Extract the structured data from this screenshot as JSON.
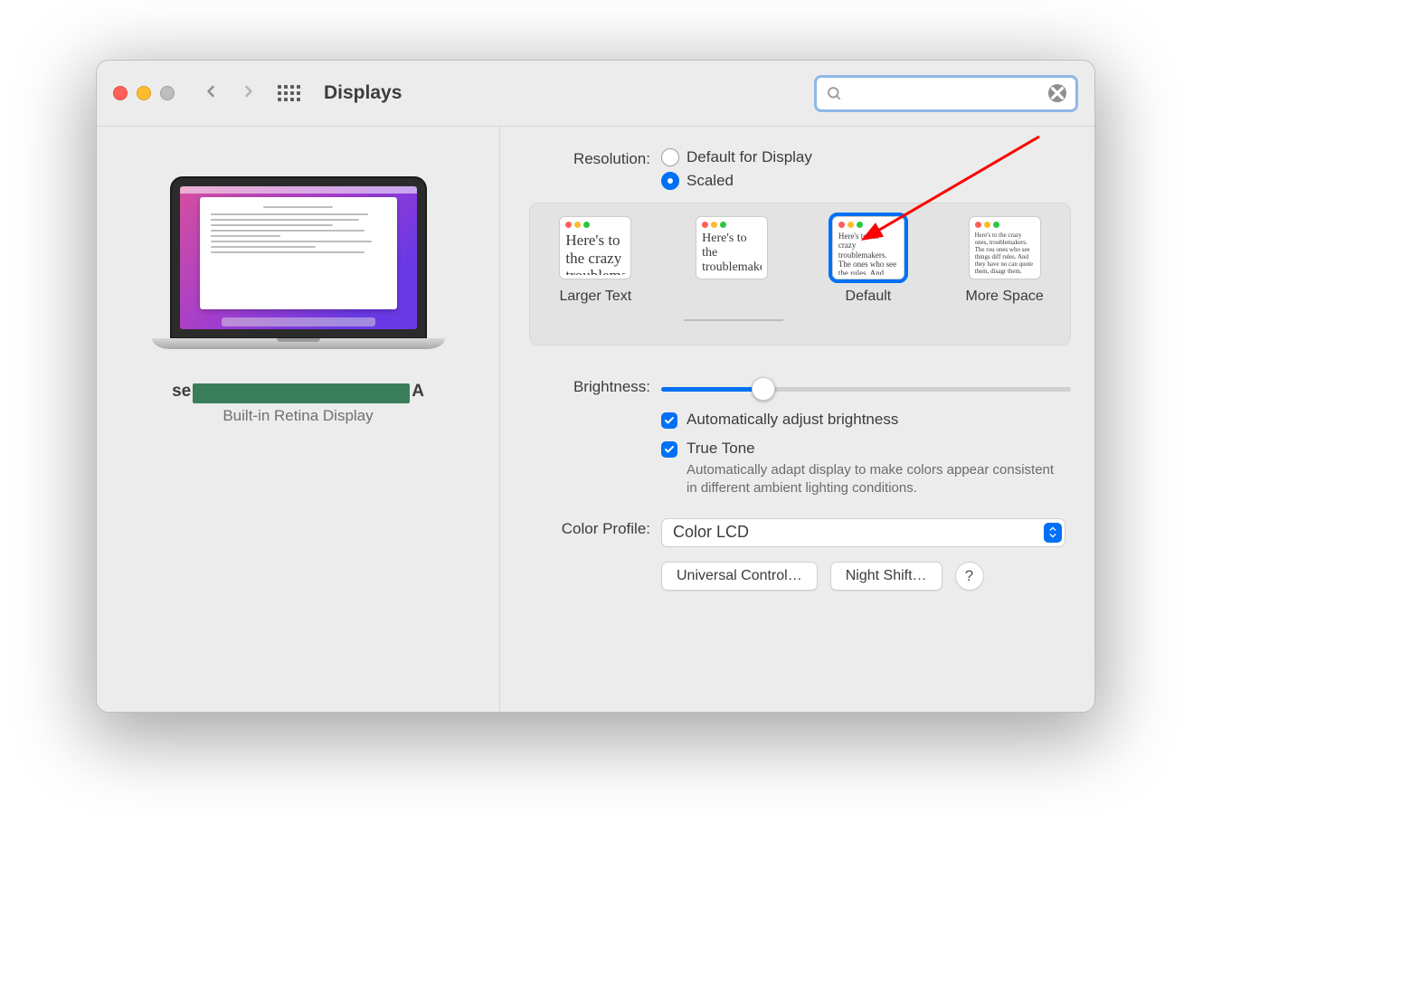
{
  "window": {
    "title": "Displays"
  },
  "search": {
    "value": "",
    "placeholder": ""
  },
  "device": {
    "name_prefix": "se",
    "name_suffix": "A",
    "subtitle": "Built-in Retina Display"
  },
  "settings": {
    "resolution": {
      "label": "Resolution:",
      "options": {
        "default": "Default for Display",
        "scaled": "Scaled"
      },
      "selected": "scaled",
      "scale_tiles": [
        {
          "label": "Larger Text",
          "sample": "Here's to the crazy troublemakers.",
          "fontsize": 17
        },
        {
          "label": "",
          "sample": "Here's to the troublemakers ones who",
          "fontsize": 14
        },
        {
          "label": "Default",
          "sample": "Here's to the crazy troublemakers. The ones who see the rules. And they",
          "fontsize": 9,
          "selected": true
        },
        {
          "label": "More Space",
          "sample": "Here's to the crazy ones, troublemakers. The rou ones who see things diff rules. And they have no can quote them, disagr them. About the only th Because they change t",
          "fontsize": 7
        }
      ]
    },
    "brightness": {
      "label": "Brightness:",
      "value_percent": 25,
      "auto_label": "Automatically adjust brightness",
      "auto_checked": true,
      "truetone_label": "True Tone",
      "truetone_checked": true,
      "truetone_desc": "Automatically adapt display to make colors appear consistent in different ambient lighting conditions."
    },
    "color_profile": {
      "label": "Color Profile:",
      "value": "Color LCD"
    }
  },
  "footer": {
    "universal_control": "Universal Control…",
    "night_shift": "Night Shift…"
  }
}
